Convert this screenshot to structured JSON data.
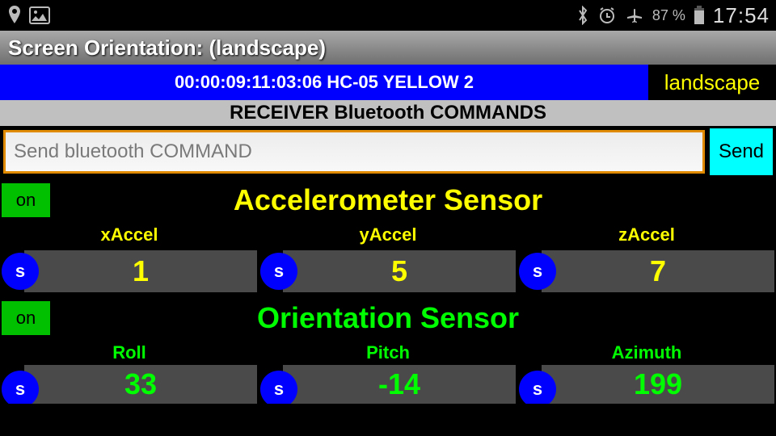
{
  "status": {
    "battery_pct": "87 %",
    "clock": "17:54"
  },
  "title_bar": "Screen Orientation: (landscape)",
  "connection": {
    "info": "00:00:09:11:03:06 HC-05 YELLOW 2",
    "mode": "landscape"
  },
  "receiver_header": "RECEIVER Bluetooth COMMANDS",
  "command": {
    "placeholder": "Send bluetooth COMMAND",
    "send_label": "Send"
  },
  "accel": {
    "on_label": "on",
    "title": "Accelerometer Sensor",
    "s_label": "s",
    "cols": [
      {
        "label": "xAccel",
        "value": "1"
      },
      {
        "label": "yAccel",
        "value": "5"
      },
      {
        "label": "zAccel",
        "value": "7"
      }
    ]
  },
  "orient": {
    "on_label": "on",
    "title": "Orientation Sensor",
    "s_label": "s",
    "cols": [
      {
        "label": "Roll",
        "value": "33"
      },
      {
        "label": "Pitch",
        "value": "-14"
      },
      {
        "label": "Azimuth",
        "value": "199"
      }
    ]
  }
}
